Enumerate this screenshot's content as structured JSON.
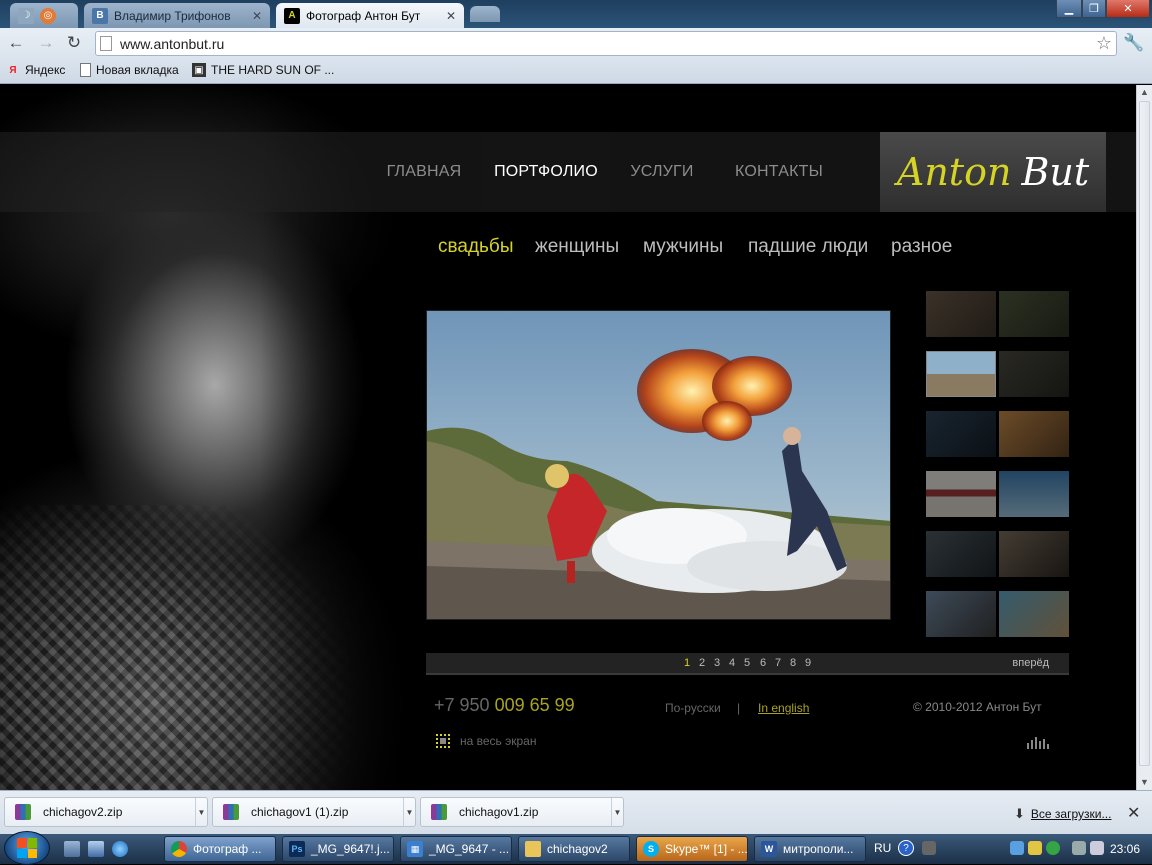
{
  "browser": {
    "tabs": [
      {
        "label": "",
        "active": false
      },
      {
        "label": "Владимир Трифонов",
        "active": false
      },
      {
        "label": "Фотограф Антон Бут",
        "active": true
      }
    ],
    "url": "www.antonbut.ru",
    "bookmarks": [
      "Яндекс",
      "Новая вкладка",
      "THE HARD SUN OF ..."
    ]
  },
  "site": {
    "logo": {
      "part1": "Anton",
      "part2": "But"
    },
    "nav": [
      "ГЛАВНАЯ",
      "ПОРТФОЛИО",
      "УСЛУГИ",
      "КОНТАКТЫ"
    ],
    "nav_active": "ПОРТФОЛИО",
    "categories": [
      "свадьбы",
      "женщины",
      "мужчины",
      "падшие люди",
      "разное"
    ],
    "category_active": "свадьбы",
    "pager": {
      "pages": [
        "1",
        "2",
        "3",
        "4",
        "5",
        "6",
        "7",
        "8",
        "9"
      ],
      "current": "1",
      "next": "вперёд"
    },
    "phone": {
      "prefix": "+7 950",
      "number": "009 65 99"
    },
    "languages": {
      "ru": "По-русски",
      "separator": "|",
      "en": "In english"
    },
    "copyright": "© 2010-2012 Антон Бут",
    "fullscreen": "на весь экран"
  },
  "downloads": {
    "items": [
      "chichagov2.zip",
      "chichagov1 (1).zip",
      "chichagov1.zip"
    ],
    "all": "Все загрузки..."
  },
  "taskbar": {
    "tasks": [
      "Фотограф ...",
      "_MG_9647!.j...",
      "_MG_9647 - ...",
      "chichagov2",
      "Skype™ [1] - ...",
      "митрополи..."
    ],
    "lang": "RU",
    "time": "23:06"
  },
  "colors": {
    "accent": "#d6d327",
    "page_bg": "#000000"
  }
}
